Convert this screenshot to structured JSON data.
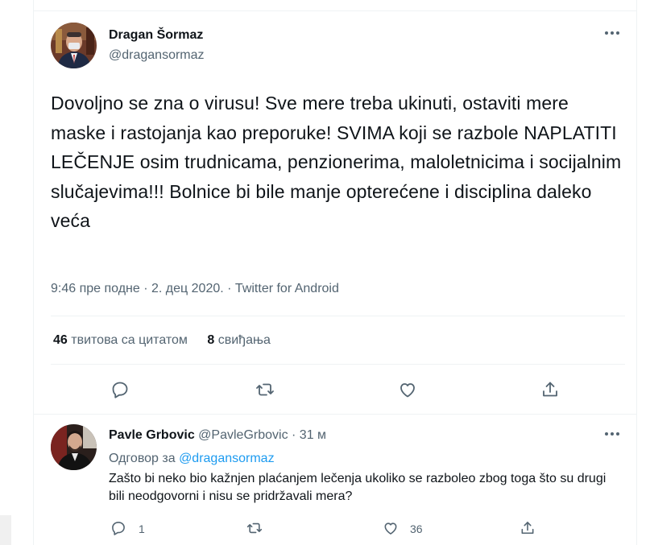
{
  "tweet": {
    "author_name": "Dragan Šormaz",
    "author_handle": "@dragansormaz",
    "more_icon": "more-horizontal-icon",
    "text": "Dovoljno se zna o virusu! Sve mere treba ukinuti, ostaviti mere maske i rastojanja kao preporuke! SVIMA koji se razbole NAPLATITI LEČENJE osim trudnicama, penzionerima, maloletnicima i socijalnim slučajevima!!! Bolnice bi bile manje opterećene i disciplina daleko veća",
    "time": "9:46 пре подне",
    "sep": "·",
    "date": "2. дец 2020.",
    "source": "Twitter for Android",
    "quote_count": "46",
    "quote_label": "твитова са цитатом",
    "like_count": "8",
    "like_label": "свиђања",
    "actions": [
      "reply-icon",
      "retweet-icon",
      "like-icon",
      "share-icon"
    ]
  },
  "reply": {
    "author_name": "Pavle Grbovic",
    "author_handle": "@PavleGrbovic",
    "sep": "·",
    "time_ago": "31 м",
    "replying_label": "Одговор за",
    "replying_to": "@dragansormaz",
    "text": "Zašto bi neko bio kažnjen plaćanjem lečenja ukoliko se razboleo zbog toga što su drugi bili neodgovorni i nisu se pridržavali mera?",
    "reply_count": "1",
    "like_count": "36"
  },
  "colors": {
    "text": "#0f1419",
    "secondary": "#536471",
    "accent": "#1d9bf0",
    "border": "#eff3f4"
  }
}
